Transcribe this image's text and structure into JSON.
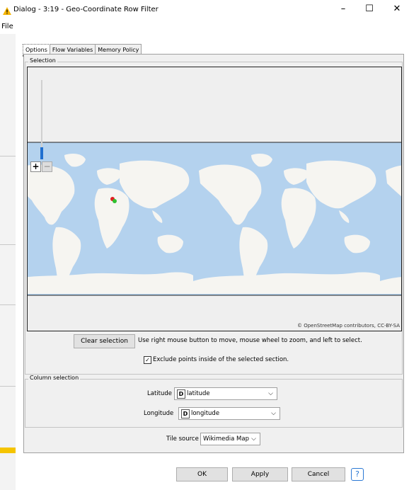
{
  "window": {
    "title": "Dialog - 3:19 - Geo-Coordinate Row Filter",
    "minimize_glyph": "–",
    "maximize_glyph": "☐",
    "close_glyph": "✕"
  },
  "menu": {
    "file": "File"
  },
  "tabs": [
    "Options",
    "Flow Variables",
    "Memory Policy"
  ],
  "selection": {
    "legend": "Selection",
    "map_attribution": "© OpenStreetMap contributors, CC-BY-SA",
    "zoom_in": "+",
    "zoom_out": "−",
    "clear_button": "Clear selection",
    "hint": "Use right mouse button to move, mouse wheel to zoom, and left to select.",
    "exclude_label": "Exclude points inside of the selected section.",
    "exclude_checked": true
  },
  "column_selection": {
    "legend": "Column selection",
    "latitude_label": "Latitude",
    "latitude_value": "latitude",
    "longitude_label": "Longitude",
    "longitude_value": "longitude",
    "type_badge": "D"
  },
  "tile_source": {
    "label": "Tile source",
    "value": "Wikimedia Map"
  },
  "footer": {
    "ok": "OK",
    "apply": "Apply",
    "cancel": "Cancel",
    "help": "?"
  },
  "colors": {
    "ocean": "#b4d2ee",
    "land": "#f6f5f1",
    "accent": "#2b78d4",
    "warning": "#f5c400"
  }
}
